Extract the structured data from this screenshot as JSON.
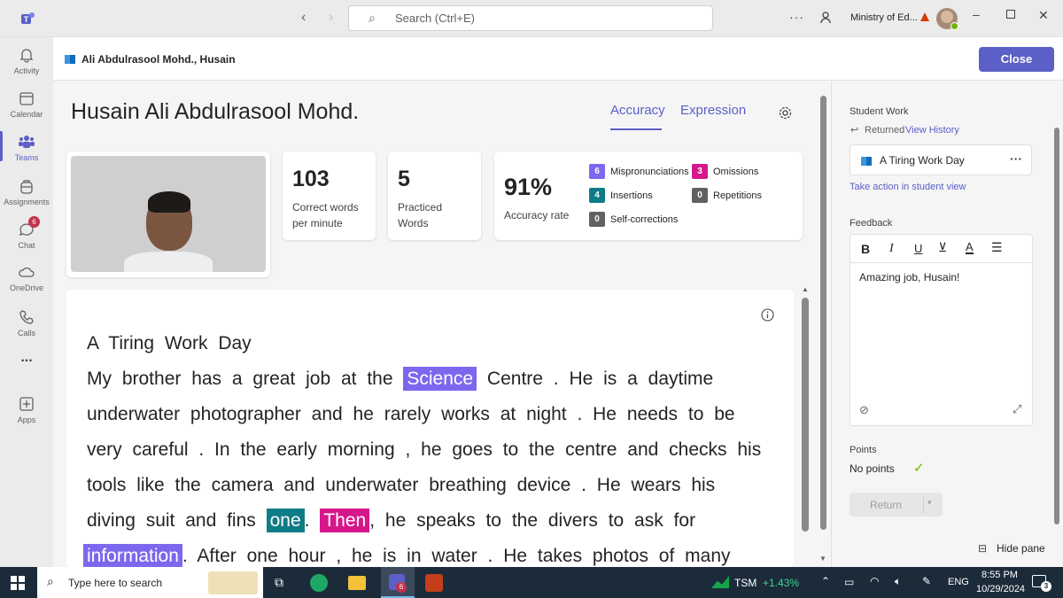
{
  "titlebar": {
    "search_placeholder": "Search (Ctrl+E)",
    "org_name": "Ministry of Ed..."
  },
  "rail": [
    {
      "label": "Activity"
    },
    {
      "label": "Calendar"
    },
    {
      "label": "Teams"
    },
    {
      "label": "Assignments"
    },
    {
      "label": "Chat",
      "badge": "6"
    },
    {
      "label": "OneDrive"
    },
    {
      "label": "Calls"
    },
    {
      "label": "..."
    },
    {
      "label": "Apps"
    }
  ],
  "header": {
    "title": "Ali Abdulrasool Mohd., Husain",
    "close_label": "Close"
  },
  "student": {
    "name": "Husain Ali Abdulrasool Mohd.",
    "tabs": [
      "Accuracy",
      "Expression"
    ]
  },
  "stats": {
    "wpm_value": "103",
    "wpm_label_1": "Correct words",
    "wpm_label_2": "per minute",
    "practiced_value": "5",
    "practiced_label_1": "Practiced",
    "practiced_label_2": "Words",
    "accuracy_value": "91%",
    "accuracy_label": "Accuracy rate",
    "errors": [
      {
        "count": "6",
        "label": "Mispronunciations",
        "color": "#7b68ee"
      },
      {
        "count": "3",
        "label": "Omissions",
        "color": "#d6178b"
      },
      {
        "count": "4",
        "label": "Insertions",
        "color": "#0e7c86"
      },
      {
        "count": "0",
        "label": "Repetitions",
        "color": "#616161"
      },
      {
        "count": "0",
        "label": "Self-corrections",
        "color": "#616161"
      }
    ]
  },
  "passage": {
    "title": "A Tiring Work Day",
    "l1a": "My brother has a great job at the",
    "l1hl": "Science",
    "l1b": "Centre . He is a daytime",
    "l2": "underwater photographer and he rarely works at night . He needs to be",
    "l3": "very careful . In the early morning , he goes to the centre and checks his",
    "l4": "tools like the camera and underwater breathing device . He wears his",
    "l5a": "diving suit and fins",
    "l5hl1": "one",
    "l5dot": ".",
    "l5hl2": "Then",
    "l5b": ", he speaks to the divers to ask for",
    "l6hl": "information",
    "l6b": ". After one hour , he is in water . He takes photos of many"
  },
  "side": {
    "student_work_label": "Student Work",
    "returned_label": "Returned",
    "view_history": "View History",
    "file_name": "A Tiring Work Day",
    "take_action": "Take action in student view",
    "feedback_label": "Feedback",
    "feedback_text": "Amazing job, Husain!",
    "points_label": "Points",
    "points_value": "No points",
    "return_label": "Return",
    "hide_pane": "Hide pane"
  },
  "taskbar": {
    "search_placeholder": "Type here to search",
    "teams_badge": "6",
    "stock_name": "TSM",
    "stock_change": "+1.43%",
    "lang": "ENG",
    "time": "8:55 PM",
    "date": "10/29/2024",
    "notif": "3"
  }
}
